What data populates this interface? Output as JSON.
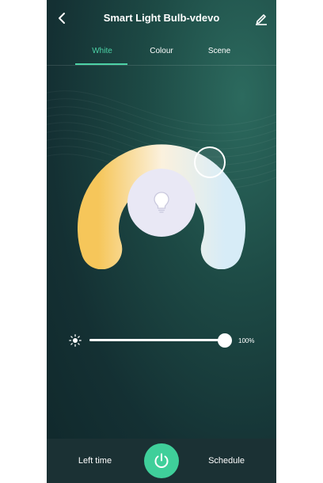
{
  "header": {
    "title": "Smart Light Bulb-vdevo",
    "back_icon": "chevron-left-icon",
    "edit_icon": "pencil-icon"
  },
  "tabs": [
    {
      "label": "White",
      "active": true
    },
    {
      "label": "Colour",
      "active": false
    },
    {
      "label": "Scene",
      "active": false
    }
  ],
  "dial": {
    "warm_color": "#f6c65a",
    "cool_color": "#d7ecf7",
    "center_icon": "lightbulb-icon"
  },
  "brightness": {
    "icon": "sun-icon",
    "value": 100,
    "label": "100%"
  },
  "footer": {
    "left_label": "Left time",
    "right_label": "Schedule",
    "power_icon": "power-icon"
  },
  "colors": {
    "accent": "#4cd2a6",
    "power": "#3fcf9a",
    "background": "#143033"
  }
}
